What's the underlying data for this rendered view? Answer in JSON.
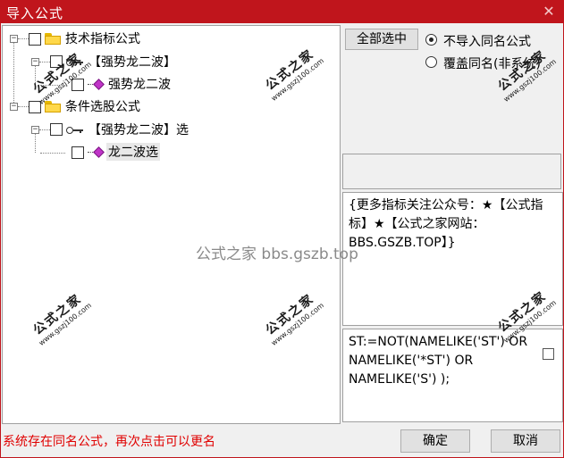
{
  "window": {
    "title": "导入公式"
  },
  "tree": {
    "nodes": [
      {
        "label": "技术指标公式"
      },
      {
        "label": "【强势龙二波】"
      },
      {
        "label": "强势龙二波"
      },
      {
        "label": "条件选股公式"
      },
      {
        "label": "【强势龙二波】选"
      },
      {
        "label": "龙二波选"
      }
    ]
  },
  "watermarks": {
    "cn": "公式之家",
    "en": "www.gszj100.com",
    "center": "公式之家 bbs.gszb.top"
  },
  "options": {
    "select_all": "全部选中",
    "radios": [
      {
        "label": "不导入同名公式",
        "checked": true
      },
      {
        "label": "覆盖同名(非系统)",
        "checked": false
      }
    ]
  },
  "description": "{更多指标关注公众号：★【公式指标】★【公式之家网站：BBS.GSZB.TOP】}",
  "code": "ST:=NOT(NAMELIKE('ST') OR NAMELIKE('*ST') OR NAMELIKE('S')  );",
  "status": "系统存在同名公式，再次点击可以更名",
  "buttons": {
    "ok": "确定",
    "cancel": "取消"
  },
  "icons": [
    "folder-icon",
    "key-icon",
    "gem-icon",
    "close-icon"
  ],
  "colors": {
    "titlebar": "#c0151c",
    "status": "#e00000"
  }
}
